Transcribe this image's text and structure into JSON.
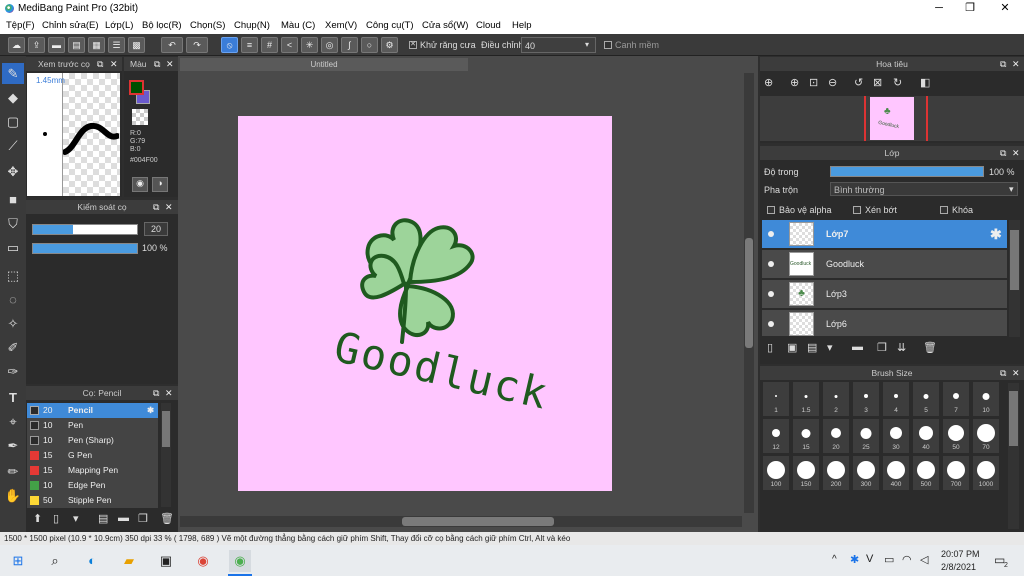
{
  "window": {
    "title": "MediBang Paint Pro (32bit)"
  },
  "menu": [
    "Tệp(F)",
    "Chỉnh sửa(E)",
    "Lớp(L)",
    "Bộ lọc(R)",
    "Chọn(S)",
    "Chụp(N)",
    "Màu (C)",
    "Xem(V)",
    "Công cụ(T)",
    "Cửa sổ(W)",
    "Cloud",
    "Help"
  ],
  "toolbar": {
    "antialias_label": "Khử răng cưa",
    "adjust_label": "Điều chỉnh",
    "adjust_value": "40",
    "smooth_label": "Canh mềm"
  },
  "brush_preview": {
    "title": "Xem trước cọ",
    "size_label": "1.45mm"
  },
  "color_panel": {
    "title": "Màu",
    "r": "R:0",
    "g": "G:79",
    "b": "B:0",
    "hex": "#004F00",
    "fg_color": "#004f00",
    "bg_color": "#6a5acd"
  },
  "brush_control": {
    "title": "Kiểm soát cọ",
    "size_value": "20",
    "opacity_value": "100 %"
  },
  "brush_list": {
    "title": "Cọ: Pencil",
    "items": [
      {
        "size": "20",
        "name": "Pencil",
        "color": "#2b2b2b",
        "selected": true
      },
      {
        "size": "10",
        "name": "Pen",
        "color": "#2b2b2b"
      },
      {
        "size": "10",
        "name": "Pen (Sharp)",
        "color": "#2b2b2b"
      },
      {
        "size": "15",
        "name": "G Pen",
        "color": "#e53935"
      },
      {
        "size": "15",
        "name": "Mapping Pen",
        "color": "#e53935"
      },
      {
        "size": "10",
        "name": "Edge Pen",
        "color": "#43a047"
      },
      {
        "size": "50",
        "name": "Stipple Pen",
        "color": "#fdd835"
      }
    ]
  },
  "document": {
    "tab": "Untitled",
    "text": "Goodluck",
    "paper_color": "#ffc6ff"
  },
  "navigator": {
    "title": "Hoa tiêu"
  },
  "layer_panel": {
    "title": "Lớp",
    "opacity_label": "Độ trong",
    "opacity_value": "100 %",
    "opacity": 1.0,
    "blend_label": "Pha trộn",
    "blend_value": "Bình thường",
    "protect_alpha": "Bảo vệ alpha",
    "clipping": "Xén bớt",
    "lock": "Khóa",
    "layers": [
      {
        "name": "Lớp7",
        "selected": true
      },
      {
        "name": "Goodluck"
      },
      {
        "name": "Lớp3"
      },
      {
        "name": "Lớp6"
      }
    ]
  },
  "brush_size": {
    "title": "Brush Size",
    "sizes": [
      "1",
      "1.5",
      "2",
      "3",
      "4",
      "5",
      "7",
      "10",
      "12",
      "15",
      "20",
      "25",
      "30",
      "40",
      "50",
      "70",
      "100",
      "150",
      "200",
      "300",
      "400",
      "500",
      "700",
      "1000"
    ]
  },
  "status": {
    "text": "1500 * 1500 pixel   (10.9 * 10.9cm)   350 dpi   33 %   ( 1798, 689 )   Vẽ một đường thẳng bằng cách giữ phím Shift, Thay đổi cỡ cọ bằng cách giữ phím Ctrl, Alt và kéo"
  },
  "taskbar": {
    "time": "20:07 PM",
    "date": "2/8/2021",
    "notif_count": "2"
  }
}
